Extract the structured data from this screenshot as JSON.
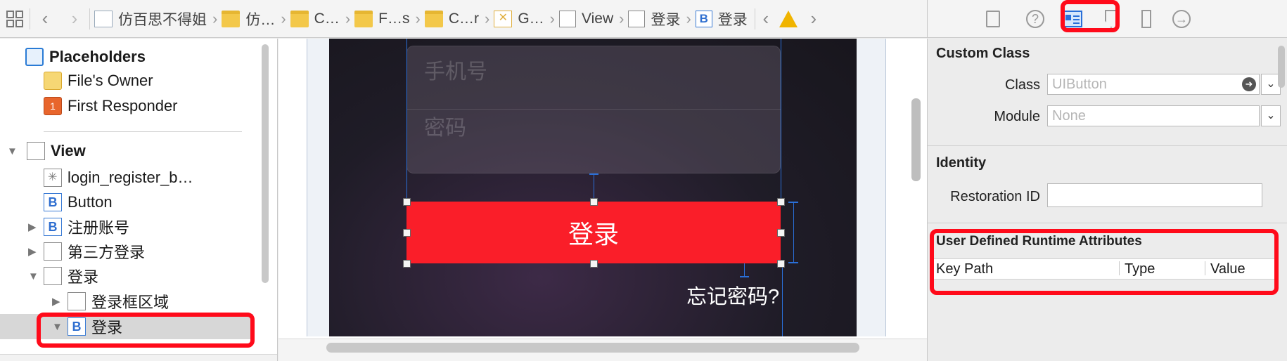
{
  "jumpbar": {
    "crumbs": [
      {
        "label": "仿百思不得姐",
        "icon": "project-icon"
      },
      {
        "label": "仿…",
        "icon": "folder-icon"
      },
      {
        "label": "C…",
        "icon": "folder-icon"
      },
      {
        "label": "F…s",
        "icon": "folder-icon"
      },
      {
        "label": "C…r",
        "icon": "folder-icon"
      },
      {
        "label": "G…",
        "icon": "xib-file-icon"
      },
      {
        "label": "View",
        "icon": "view-icon"
      },
      {
        "label": "登录",
        "icon": "view-icon"
      },
      {
        "label": "登录",
        "icon": "button-icon"
      }
    ],
    "b_letter": "B"
  },
  "outline": {
    "placeholders": "Placeholders",
    "files_owner": "File's Owner",
    "first_responder": "First Responder",
    "view": "View",
    "items": [
      {
        "label": "login_register_b…"
      },
      {
        "label": "Button"
      },
      {
        "label": "注册账号"
      },
      {
        "label": "第三方登录"
      },
      {
        "label": "登录"
      },
      {
        "label": "登录框区域"
      },
      {
        "label": "登录"
      }
    ],
    "b_letter": "B",
    "fr_badge": "1"
  },
  "canvas": {
    "phone_placeholder": "手机号",
    "password_placeholder": "密码",
    "login_button": "登录",
    "forgot_password": "忘记密码?"
  },
  "inspector": {
    "custom_class": {
      "title": "Custom Class",
      "class_label": "Class",
      "class_value": "UIButton",
      "module_label": "Module",
      "module_value": "None"
    },
    "identity": {
      "title": "Identity",
      "restoration_label": "Restoration ID",
      "restoration_value": ""
    },
    "runtime_attrs": {
      "title": "User Defined Runtime Attributes",
      "columns": [
        "Key Path",
        "Type",
        "Value"
      ]
    }
  },
  "colors": {
    "highlight": "#ff0a1a",
    "login_button": "#fa1e29",
    "accent": "#2a6fd8"
  }
}
